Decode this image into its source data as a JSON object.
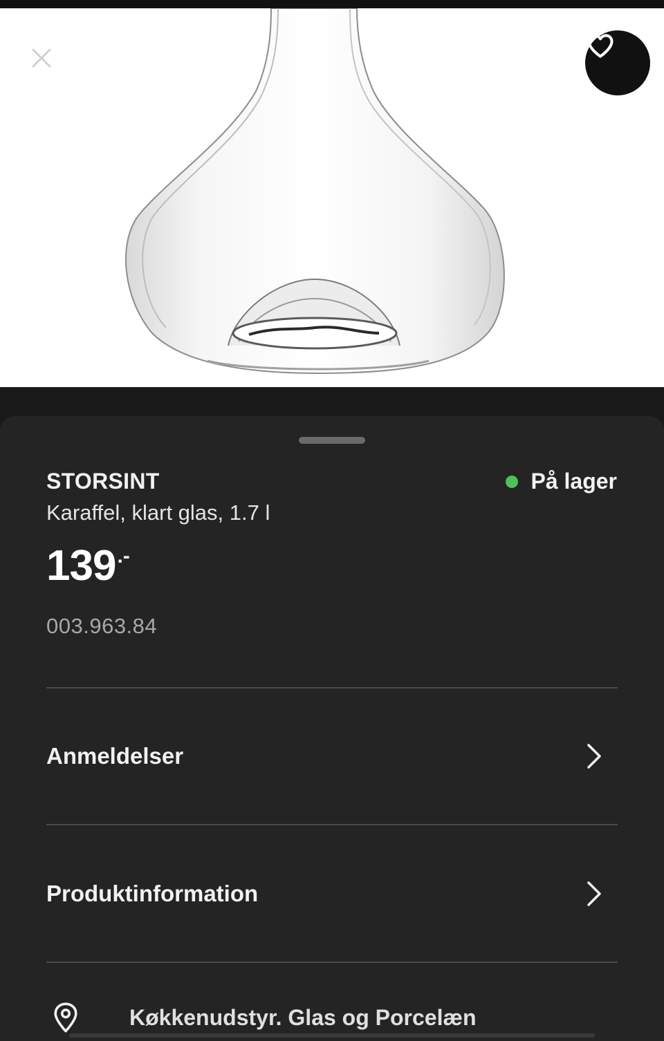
{
  "header": {
    "close_icon": "close-icon",
    "favorite_icon": "heart-icon"
  },
  "product": {
    "name": "STORSINT",
    "description": "Karaffel, klart glas, 1.7 l",
    "price": "139",
    "price_suffix": ".-",
    "article_number": "003.963.84",
    "stock_status": "På lager",
    "stock_color": "#4fbf58"
  },
  "sections": [
    {
      "label": "Anmeldelser",
      "icon": "chevron-right-icon"
    },
    {
      "label": "Produktinformation",
      "icon": "chevron-right-icon"
    }
  ],
  "location": {
    "icon": "map-pin-icon",
    "label": "Køkkenudstyr. Glas og Porcelæn"
  },
  "colors": {
    "sheet_background": "#242424",
    "hero_background": "#ffffff",
    "text_primary": "#f2f2f2",
    "text_secondary": "#a8a8a8"
  }
}
